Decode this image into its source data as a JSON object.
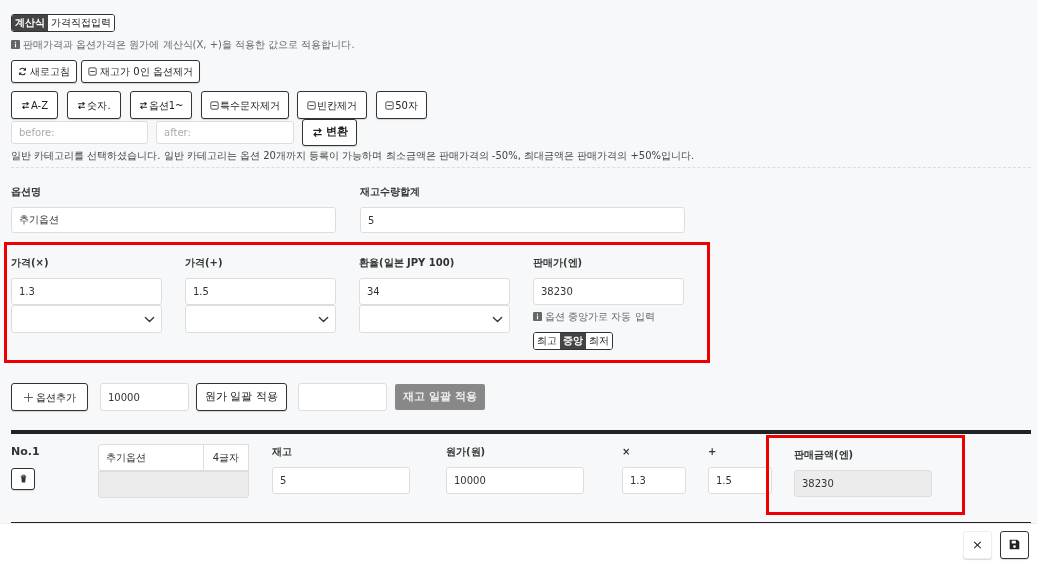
{
  "mode_tabs": [
    {
      "label": "계산식",
      "selected": true
    },
    {
      "label": "가격직접입력",
      "selected": false
    }
  ],
  "info_note": "판매가격과 옵션가격은 원가에 계산식(X, +)을 적용한 값으로 적용합니다.",
  "tool_buttons": [
    {
      "label": "새로고침",
      "kind": "refresh"
    },
    {
      "label": "재고가 0인 옵션제거",
      "kind": "remove"
    }
  ],
  "edit_buttons": [
    {
      "label": "A-Z",
      "kind": "sort"
    },
    {
      "label": "숫자.",
      "kind": "sort"
    },
    {
      "label": "옵션1~",
      "kind": "sort"
    },
    {
      "label": "특수문자제거",
      "kind": "remove"
    },
    {
      "label": "빈칸제거",
      "kind": "remove"
    },
    {
      "label": "50자",
      "kind": "remove"
    }
  ],
  "replace": {
    "before_placeholder": "before:",
    "after_placeholder": "after:",
    "button": "변환"
  },
  "category_notice": "일반 카테고리를 선택하셨습니다. 일반 카테고리는 옵션 20개까지 등록이 가능하며 최소금액은 판매가격의 -50%, 최대금액은 판매가격의 +50%입니다.",
  "summary_fields": [
    {
      "label": "옵션명",
      "value": "추기옵션"
    },
    {
      "label": "재고수량합계",
      "value": "5"
    }
  ],
  "price_section": {
    "highlighted": true,
    "fields": [
      {
        "kind": "select",
        "label": "가격(×)",
        "value": "1.3"
      },
      {
        "kind": "select",
        "label": "가격(+)",
        "value": "1.5"
      },
      {
        "kind": "select",
        "label": "환율(일본 JPY 100)",
        "value": "34"
      },
      {
        "kind": "price",
        "label": "판매가(엔)",
        "value": "38230",
        "hint": "옵션 중앙가로 자동 입력",
        "choices": [
          {
            "label": "최고",
            "selected": false
          },
          {
            "label": "중앙",
            "selected": true
          },
          {
            "label": "최저",
            "selected": false
          }
        ]
      }
    ]
  },
  "bulk": {
    "add_button": "옵션추가",
    "cost_value": "10000",
    "cost_button": "원가 일괄 적용",
    "stock_button": "재고 일괄 적용",
    "stock_disabled": true
  },
  "options": [
    {
      "number": "No.1",
      "name": "추기옵션",
      "length": "4글자",
      "columns": [
        {
          "kind": "input",
          "label": "재고",
          "value": "5",
          "highlighted": false
        },
        {
          "kind": "input",
          "label": "원가(원)",
          "value": "10000",
          "highlighted": false
        },
        {
          "kind": "small",
          "label": "×",
          "value": "1.3",
          "highlighted": false
        },
        {
          "kind": "small",
          "label": "+",
          "value": "1.5",
          "highlighted": false
        },
        {
          "kind": "readonly",
          "label": "판매금액(엔)",
          "value": "38230",
          "highlighted": true
        }
      ]
    }
  ],
  "footer": {
    "close_button": "×"
  }
}
